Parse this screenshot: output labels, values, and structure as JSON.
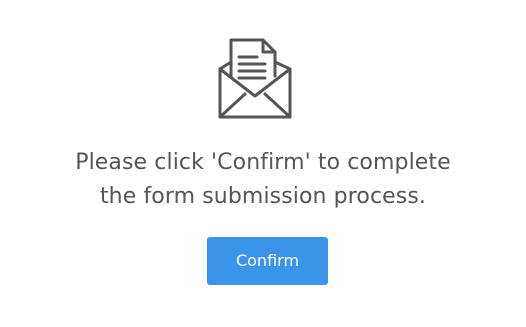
{
  "message": {
    "line1": "Please click 'Confirm' to complete",
    "line2": "the form submission process."
  },
  "confirm_button": {
    "label": "Confirm"
  },
  "icon": {
    "name": "envelope-with-document-icon",
    "stroke_color": "#555555"
  },
  "colors": {
    "button_bg": "#3a94ea",
    "button_text": "#ffffff",
    "text": "#555555"
  }
}
